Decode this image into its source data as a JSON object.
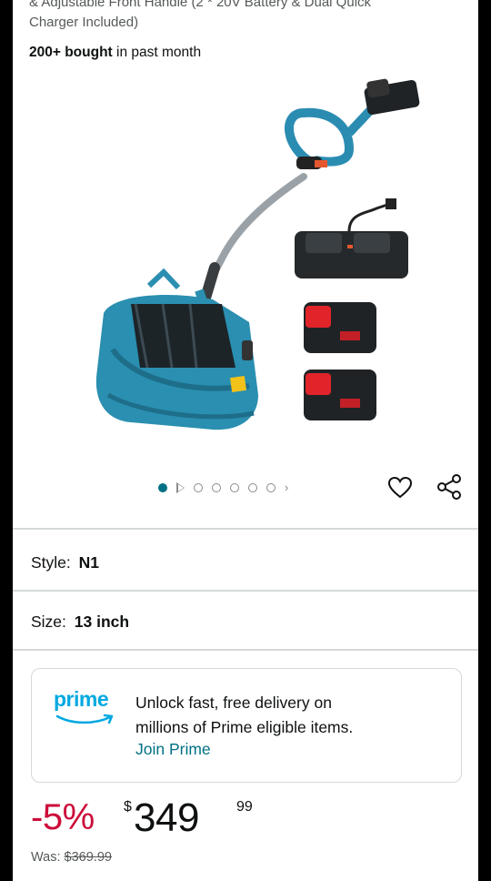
{
  "product": {
    "title_tail_line1": "& Adjustable Front Handle (2 * 20V Battery & Dual Quick",
    "title_tail_line2": "Charger Included)",
    "bought_bold": "200+ bought",
    "bought_rest": "in past month"
  },
  "gallery": {
    "image_count": 7,
    "active_index": 0
  },
  "variants": {
    "style_label": "Style:",
    "style_value": "N1",
    "size_label": "Size:",
    "size_value": "13 inch"
  },
  "prime": {
    "logo_text": "prime",
    "line1": "Unlock fast, free delivery on",
    "line2": "millions of Prime eligible items.",
    "link": "Join Prime"
  },
  "price": {
    "discount": "-5%",
    "currency": "$",
    "whole": "349",
    "fraction": "99",
    "was_label": "Was:",
    "was_value": "$369.99"
  },
  "colors": {
    "accent_link": "#007185",
    "discount_red": "#cc0c39",
    "prime_blue": "#00a8e1"
  }
}
